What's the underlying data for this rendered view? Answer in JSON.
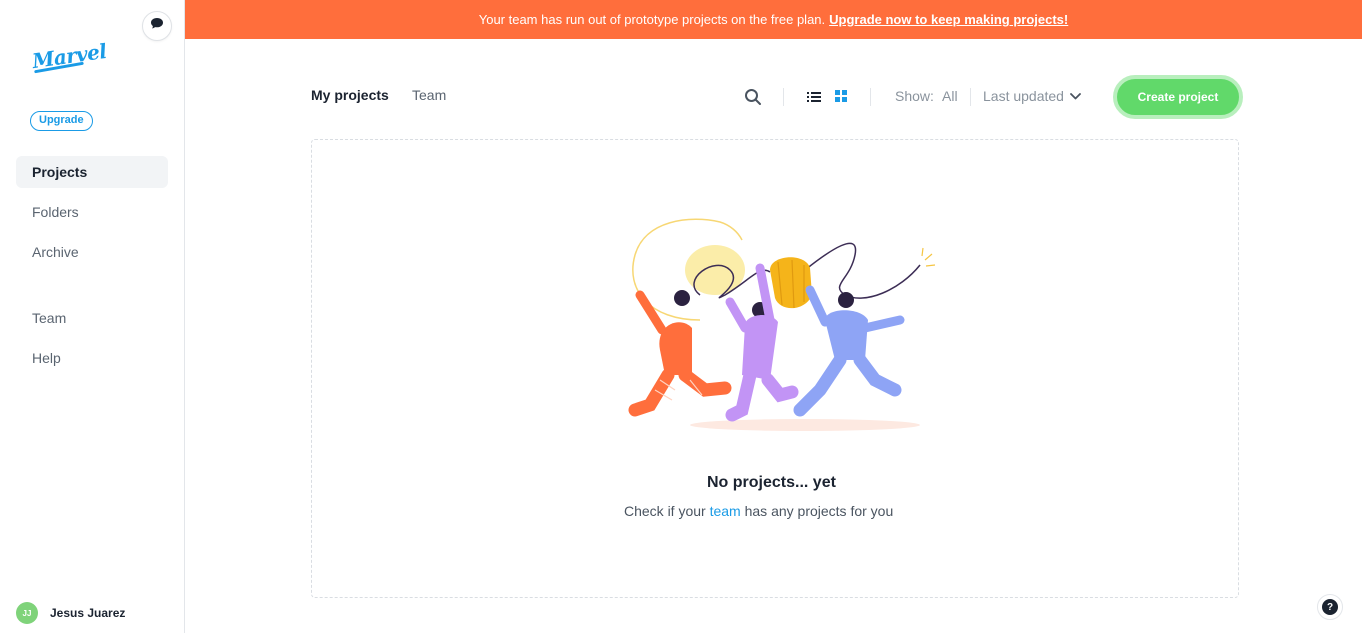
{
  "sidebar": {
    "logo_text": "Marvel",
    "upgrade_label": "Upgrade",
    "items": [
      {
        "label": "Projects",
        "active": true
      },
      {
        "label": "Folders",
        "active": false
      },
      {
        "label": "Archive",
        "active": false
      },
      {
        "label": "Team",
        "active": false
      },
      {
        "label": "Help",
        "active": false
      }
    ],
    "user": {
      "initials": "JJ",
      "name": "Jesus Juarez"
    },
    "chat_icon": "chat-bubble-icon"
  },
  "banner": {
    "message": "Your team has run out of prototype projects on the free plan.",
    "link_text": "Upgrade now to keep making projects!",
    "color": "#ff6e3c"
  },
  "toolbar": {
    "tabs": [
      {
        "label": "My projects",
        "active": true
      },
      {
        "label": "Team",
        "active": false
      }
    ],
    "search_icon": "search-icon",
    "list_view_icon": "list-view-icon",
    "grid_view_icon": "grid-view-icon",
    "show_label": "Show:",
    "show_value": "All",
    "sort_label": "Last updated",
    "create_label": "Create project",
    "accent": "#61d96a"
  },
  "empty_state": {
    "title": "No projects... yet",
    "subtitle_before": "Check if your",
    "subtitle_link": "team",
    "subtitle_after": "has any projects for you"
  },
  "help_icon": "help-icon",
  "colors": {
    "link": "#1a9be6",
    "banner": "#ff6e3c",
    "primary_button": "#61d96a"
  }
}
